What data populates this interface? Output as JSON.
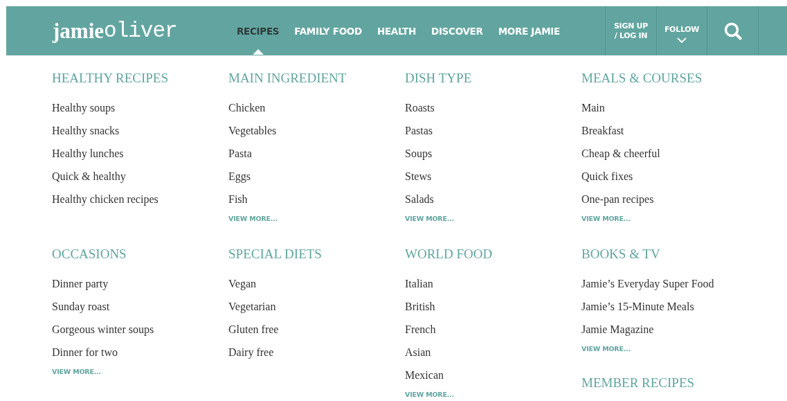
{
  "header": {
    "logo": {
      "bold": "jamie",
      "light": "oliver"
    },
    "nav": [
      {
        "label": "RECIPES",
        "selected": true
      },
      {
        "label": "FAMILY FOOD",
        "selected": false
      },
      {
        "label": "HEALTH",
        "selected": false
      },
      {
        "label": "DISCOVER",
        "selected": false
      },
      {
        "label": "MORE JAMIE",
        "selected": false
      }
    ],
    "account": {
      "line_1": "SIGN UP",
      "line_2": "/ LOG IN"
    },
    "follow": {
      "label": "FOLLOW"
    }
  },
  "menu_rows": [
    [
      [
        {
          "heading": "HEALTHY RECIPES",
          "items": [
            "Healthy soups",
            "Healthy snacks",
            "Healthy lunches",
            "Quick & healthy",
            "Healthy chicken recipes"
          ]
        }
      ],
      [
        {
          "heading": "MAIN INGREDIENT",
          "items": [
            "Chicken",
            "Vegetables",
            "Pasta",
            "Eggs",
            "Fish"
          ],
          "view_more": "VIEW MORE..."
        }
      ],
      [
        {
          "heading": "DISH TYPE",
          "items": [
            "Roasts",
            "Pastas",
            "Soups",
            "Stews",
            "Salads"
          ],
          "view_more": "VIEW MORE..."
        }
      ],
      [
        {
          "heading": "MEALS & COURSES",
          "items": [
            "Main",
            "Breakfast",
            "Cheap & cheerful",
            "Quick fixes",
            "One-pan recipes"
          ],
          "view_more": "VIEW MORE..."
        }
      ]
    ],
    [
      [
        {
          "heading": "OCCASIONS",
          "items": [
            "Dinner party",
            "Sunday roast",
            "Gorgeous winter soups",
            "Dinner for two"
          ],
          "view_more": "VIEW MORE..."
        }
      ],
      [
        {
          "heading": "SPECIAL DIETS",
          "items": [
            "Vegan",
            "Vegetarian",
            "Gluten free",
            "Dairy free"
          ]
        }
      ],
      [
        {
          "heading": "WORLD FOOD",
          "items": [
            "Italian",
            "British",
            "French",
            "Asian",
            "Mexican"
          ],
          "view_more": "VIEW MORE..."
        }
      ],
      [
        {
          "heading": "BOOKS & TV",
          "items": [
            "Jamie’s Everyday Super Food",
            "Jamie’s 15-Minute Meals",
            "Jamie Magazine"
          ],
          "view_more": "VIEW MORE..."
        },
        {
          "heading": "MEMBER RECIPES"
        }
      ]
    ]
  ]
}
